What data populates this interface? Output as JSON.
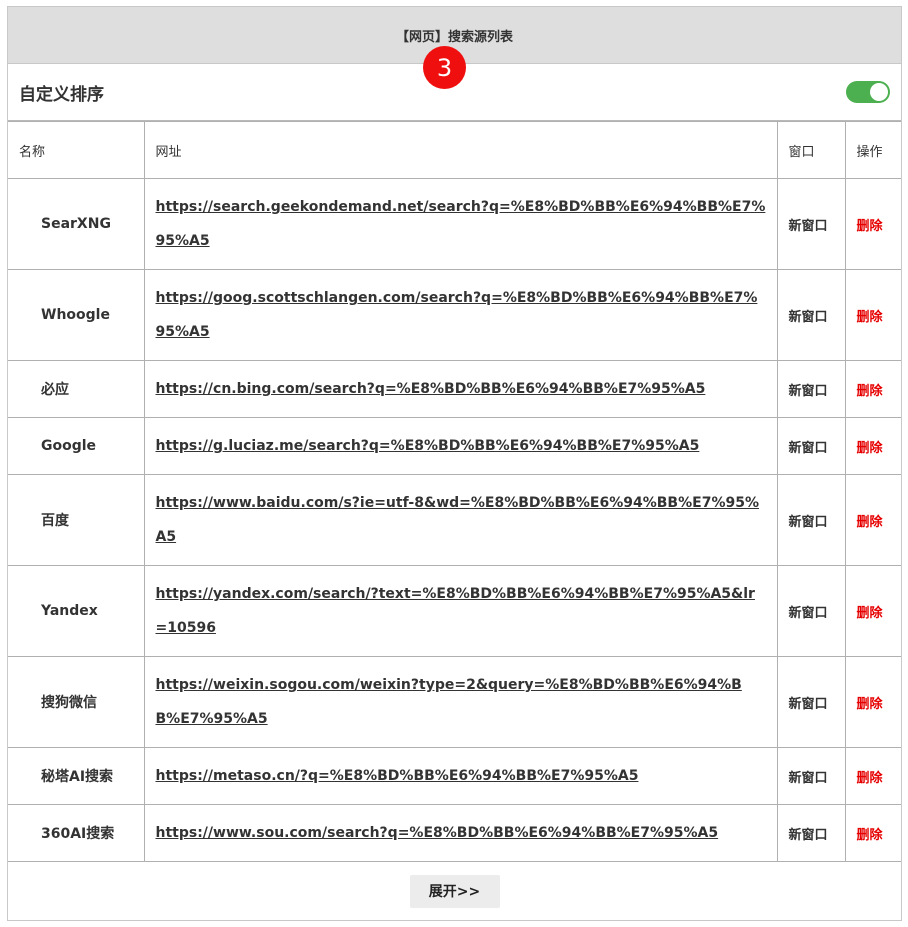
{
  "header": {
    "title": "【网页】搜索源列表"
  },
  "badge": {
    "number": "3"
  },
  "sort": {
    "label": "自定义排序",
    "enabled": true
  },
  "table": {
    "columns": [
      "名称",
      "网址",
      "窗口",
      "操作"
    ],
    "rows": [
      {
        "name": "SearXNG",
        "url": "https://search.geekondemand.net/search?q=%E8%BD%BB%E6%94%BB%E7%95%A5",
        "window": "新窗口",
        "action": "删除"
      },
      {
        "name": "Whoogle",
        "url": "https://goog.scottschlangen.com/search?q=%E8%BD%BB%E6%94%BB%E7%95%A5",
        "window": "新窗口",
        "action": "删除"
      },
      {
        "name": "必应",
        "url": "https://cn.bing.com/search?q=%E8%BD%BB%E6%94%BB%E7%95%A5",
        "window": "新窗口",
        "action": "删除"
      },
      {
        "name": "Google",
        "url": "https://g.luciaz.me/search?q=%E8%BD%BB%E6%94%BB%E7%95%A5",
        "window": "新窗口",
        "action": "删除"
      },
      {
        "name": "百度",
        "url": "https://www.baidu.com/s?ie=utf-8&wd=%E8%BD%BB%E6%94%BB%E7%95%A5",
        "window": "新窗口",
        "action": "删除"
      },
      {
        "name": "Yandex",
        "url": "https://yandex.com/search/?text=%E8%BD%BB%E6%94%BB%E7%95%A5&lr=10596",
        "window": "新窗口",
        "action": "删除"
      },
      {
        "name": "搜狗微信",
        "url": "https://weixin.sogou.com/weixin?type=2&query=%E8%BD%BB%E6%94%BB%E7%95%A5",
        "window": "新窗口",
        "action": "删除"
      },
      {
        "name": "秘塔AI搜索",
        "url": "https://metaso.cn/?q=%E8%BD%BB%E6%94%BB%E7%95%A5",
        "window": "新窗口",
        "action": "删除"
      },
      {
        "name": "360AI搜索",
        "url": "https://www.sou.com/search?q=%E8%BD%BB%E6%94%BB%E7%95%A5",
        "window": "新窗口",
        "action": "删除"
      }
    ]
  },
  "footer": {
    "expand_label": "展开>>"
  },
  "colors": {
    "toggle_on": "#4caf50",
    "delete_red": "#e60000",
    "badge_red": "#f00f0f",
    "header_bg": "#dedede"
  }
}
